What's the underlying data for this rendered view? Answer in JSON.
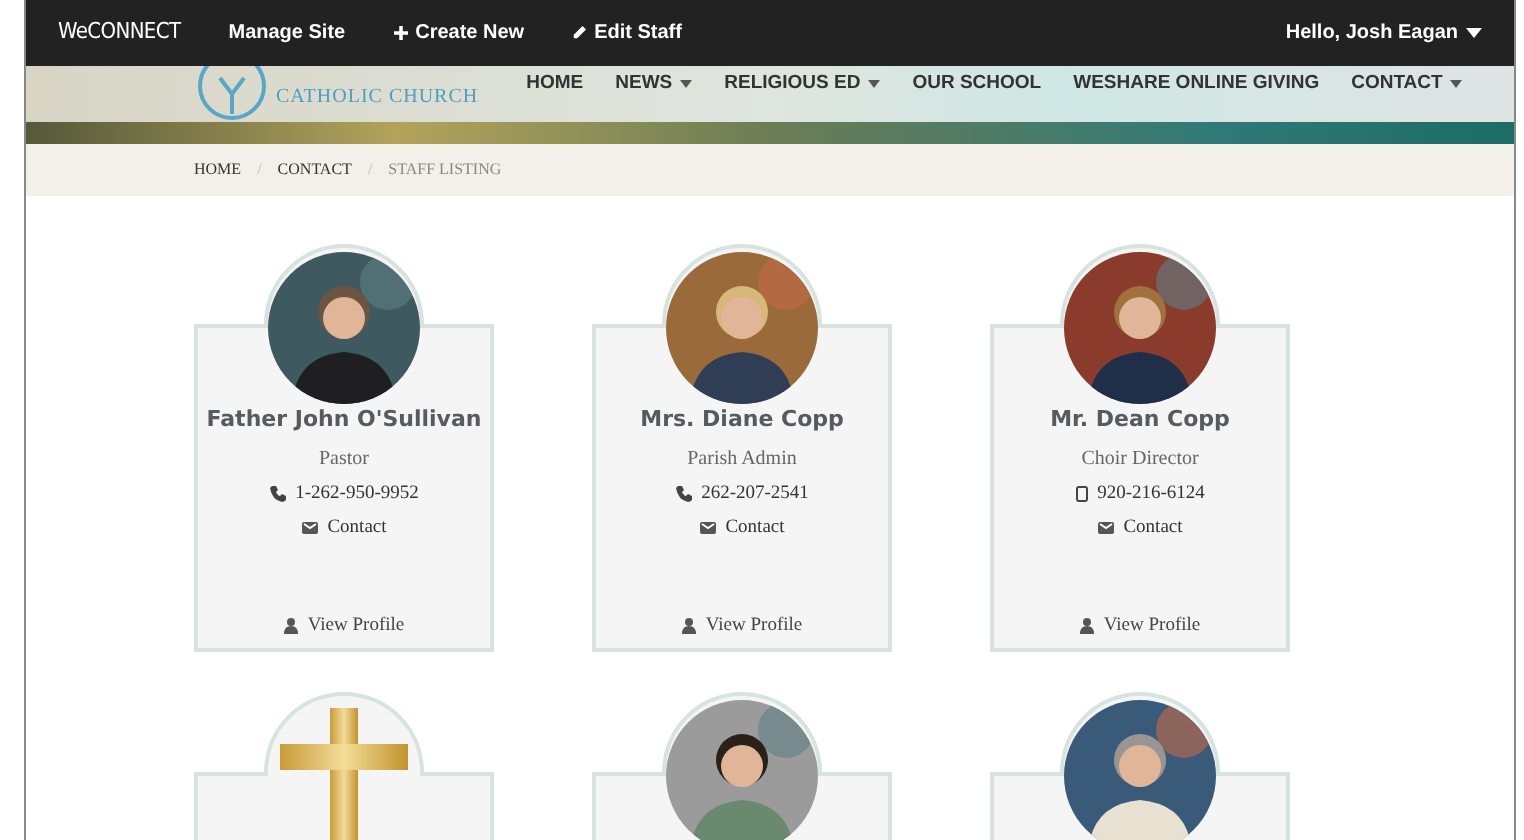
{
  "admin_bar": {
    "brand": "WeCONNECT",
    "links": [
      {
        "kind": "plain",
        "label": "Manage Site"
      },
      {
        "kind": "create",
        "label": "Create New"
      },
      {
        "kind": "edit",
        "label": "Edit Staff"
      }
    ],
    "user": "Hello, Josh Eagan"
  },
  "site_header": {
    "logo_text": "CATHOLIC CHURCH",
    "nav": [
      {
        "label": "HOME",
        "dropdown": false
      },
      {
        "label": "NEWS",
        "dropdown": true
      },
      {
        "label": "RELIGIOUS ED",
        "dropdown": true
      },
      {
        "label": "OUR SCHOOL",
        "dropdown": false
      },
      {
        "label": "WESHARE ONLINE GIVING",
        "dropdown": false
      },
      {
        "label": "CONTACT",
        "dropdown": true
      }
    ]
  },
  "breadcrumb": [
    "HOME",
    "/",
    "CONTACT",
    "/",
    "STAFF LISTING"
  ],
  "staff": [
    {
      "kind": "person",
      "name": "Father John O'Sullivan",
      "role": "Pastor",
      "phone": {
        "kind": "landline",
        "number": "1-262-950-9952"
      },
      "contact": "Contact",
      "profile": "View Profile"
    },
    {
      "kind": "person",
      "name": "Mrs. Diane Copp",
      "role": "Parish Admin",
      "phone": {
        "kind": "landline",
        "number": "262-207-2541"
      },
      "contact": "Contact",
      "profile": "View Profile"
    },
    {
      "kind": "person",
      "name": "Mr. Dean Copp",
      "role": "Choir Director",
      "phone": {
        "kind": "mobile",
        "number": "920-216-6124"
      },
      "contact": "Contact",
      "profile": "View Profile"
    },
    {
      "kind": "cross"
    },
    {
      "kind": "person"
    },
    {
      "kind": "person"
    }
  ]
}
